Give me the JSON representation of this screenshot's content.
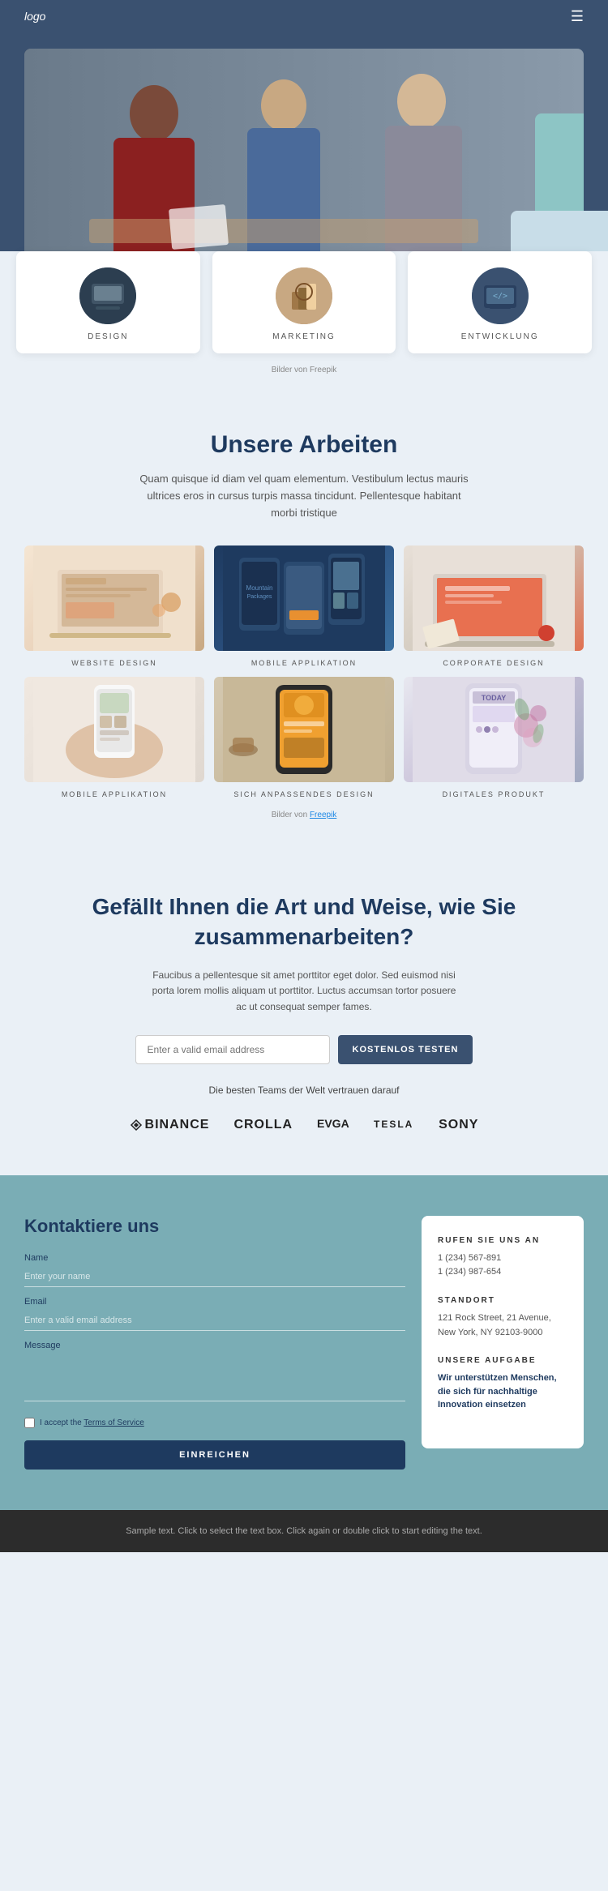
{
  "nav": {
    "logo": "logo",
    "menu_icon": "☰"
  },
  "service_cards": [
    {
      "label": "DESIGN",
      "circle_class": "circle-design"
    },
    {
      "label": "MARKETING",
      "circle_class": "circle-marketing"
    },
    {
      "label": "ENTWICKLUNG",
      "circle_class": "circle-entwicklung"
    }
  ],
  "freepik_credit": "Bilder von Freepik",
  "works": {
    "title": "Unsere Arbeiten",
    "description": "Quam quisque id diam vel quam elementum. Vestibulum lectus mauris ultrices eros in cursus turpis massa tincidunt. Pellentesque habitant morbi tristique",
    "items": [
      {
        "label": "WEBSITE DESIGN",
        "img_class": "work-img-website",
        "icon": "laptop"
      },
      {
        "label": "MOBILE APPLIKATION",
        "img_class": "work-img-mobile",
        "icon": "phones"
      },
      {
        "label": "CORPORATE DESIGN",
        "img_class": "work-img-corporate",
        "icon": "laptop"
      },
      {
        "label": "MOBILE APPLIKATION",
        "img_class": "work-img-mobile2",
        "icon": "phone"
      },
      {
        "label": "SICH ANPASSENDES DESIGN",
        "img_class": "work-img-responsive",
        "icon": "phone"
      },
      {
        "label": "DIGITALES PRODUKT",
        "img_class": "work-img-digital",
        "icon": "phone"
      }
    ],
    "freepik_credit": "Bilder von ",
    "freepik_link": "Freepik"
  },
  "cta": {
    "title": "Gefällt Ihnen die Art und Weise, wie Sie zusammenarbeiten?",
    "description": "Faucibus a pellentesque sit amet porttitor eget dolor. Sed euismod nisi porta lorem mollis aliquam ut porttitor. Luctus accumsan tortor posuere ac ut consequat semper fames.",
    "input_placeholder": "Enter a valid email address",
    "button_label": "KOSTENLOS TESTEN",
    "trust_text": "Die besten Teams der Welt vertrauen darauf",
    "brands": [
      {
        "name": "⬡ BINANCE",
        "id": "binance"
      },
      {
        "name": "CROLLA",
        "id": "crolla"
      },
      {
        "name": "EVGA",
        "id": "evga"
      },
      {
        "name": "TESLA",
        "id": "tesla"
      },
      {
        "name": "SONY",
        "id": "sony"
      }
    ]
  },
  "contact": {
    "title": "Kontaktiere uns",
    "fields": {
      "name_label": "Name",
      "name_placeholder": "Enter your name",
      "email_label": "Email",
      "email_placeholder": "Enter a valid email address",
      "message_label": "Message",
      "message_placeholder": ""
    },
    "terms_text": "I accept the Terms of Service",
    "submit_label": "EINREICHEN"
  },
  "info": {
    "phone_heading": "RUFEN SIE UNS AN",
    "phone_1": "1 (234) 567-891",
    "phone_2": "1 (234) 987-654",
    "location_heading": "STANDORT",
    "location_text": "121 Rock Street, 21 Avenue, New York, NY 92103-9000",
    "mission_heading": "UNSERE AUFGABE",
    "mission_text": "Wir unterstützen Menschen, die sich für nachhaltige Innovation einsetzen"
  },
  "footer": {
    "text": "Sample text. Click to select the text box. Click again or double click to start editing the text."
  }
}
